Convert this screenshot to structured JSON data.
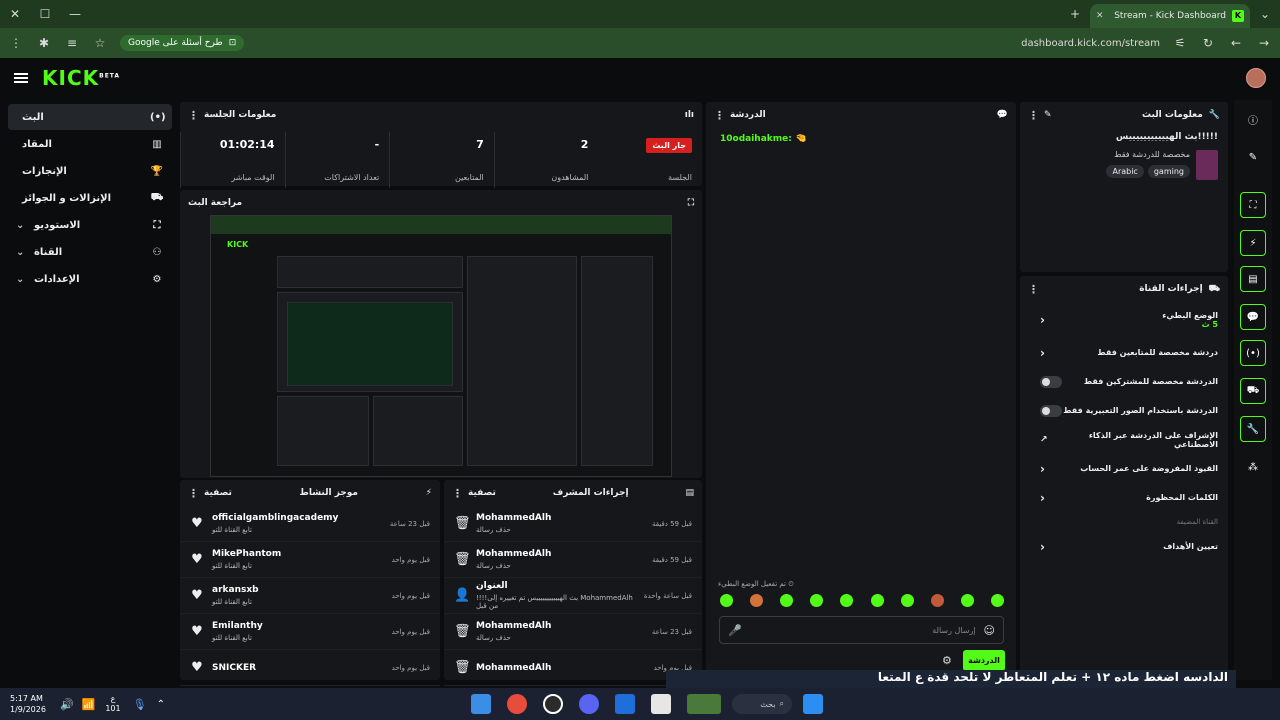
{
  "browser": {
    "tab_title": "Stream - Kick Dashboard",
    "url": "dashboard.kick.com/stream",
    "google_pill": "Google طرح أسئلة على"
  },
  "header": {
    "logo": "KICK",
    "beta": "BETA"
  },
  "nav": [
    {
      "label": "البث",
      "icon": "(•)"
    },
    {
      "label": "المقاد",
      "icon": "▥"
    },
    {
      "label": "الإنجازات",
      "icon": "🏆"
    },
    {
      "label": "الإنزالات و الجوائز",
      "icon": "⛟"
    },
    {
      "label": "الاستوديو",
      "icon": "⛶"
    },
    {
      "label": "القناة",
      "icon": "⚇"
    },
    {
      "label": "الإعدادات",
      "icon": "⚙"
    }
  ],
  "session": {
    "title": "معلومات الجلسة",
    "live_button": "جار البث",
    "session_label": "الجلسة",
    "viewers_value": "2",
    "viewers_label": "المشاهدون",
    "followers_value": "7",
    "followers_label": "المتابعين",
    "subs_value": "-",
    "subs_label": "تعداد الاشتراكات",
    "live_time_value": "01:02:14",
    "live_time_label": "الوقت مباشر"
  },
  "preview": {
    "title": "مراجعة البث"
  },
  "activity": {
    "title": "موجز النشاط",
    "filter": "تصفية",
    "items": [
      {
        "name": "officialgamblingacademy",
        "sub": "تابع القناة للتو",
        "time": "قبل 23 ساعة"
      },
      {
        "name": "MikePhantom",
        "sub": "تابع القناة للتو",
        "time": "قبل يوم واحد"
      },
      {
        "name": "arkansxb",
        "sub": "تابع القناة للتو",
        "time": "قبل يوم واحد"
      },
      {
        "name": "Emilanthy",
        "sub": "تابع القناة للتو",
        "time": "قبل يوم واحد"
      },
      {
        "name": "SNICKER",
        "sub": "",
        "time": "قبل يوم واحد"
      }
    ]
  },
  "mod": {
    "title": "إجراءات المشرف",
    "filter": "تصفية",
    "items": [
      {
        "name": "MohammedAlh",
        "sub": "حذف رسالة",
        "time": "قبل 59 دقيقة"
      },
      {
        "name": "MohammedAlh",
        "sub": "حذف رسالة",
        "time": "قبل 59 دقيقة"
      },
      {
        "name": "العنوان",
        "sub": "!!!!بث الهيييييييييييس تم تغييره إلى MohammedAlh من قبل",
        "time": "قبل ساعة واحدة"
      },
      {
        "name": "MohammedAlh",
        "sub": "حذف رسالة",
        "time": "قبل 23 ساعة"
      },
      {
        "name": "MohammedAlh",
        "sub": "",
        "time": "قبل يوم واحد"
      }
    ]
  },
  "chat": {
    "title": "الدردشة",
    "message_user": "10odaihakme:",
    "slow_mode_notice": "تم تفعيل الوضع البطيء",
    "input_placeholder": "إرسال رسالة",
    "send_button": "الدردشة"
  },
  "stream_info": {
    "title": "معلومات البث",
    "stream_title": "!!!!!بث الهيييييييييييس",
    "category": "مخصصة للدردشة فقط",
    "tags": [
      "Arabic",
      "gaming"
    ]
  },
  "channel_actions": {
    "title": "إجراءات القناة",
    "items": [
      {
        "label": "الوضع البطيء",
        "sub": "5 ث",
        "control": "chevron"
      },
      {
        "label": "دردشة مخصصة للمتابعين فقط",
        "control": "chevron"
      },
      {
        "label": "الدردشة مخصصة للمشتركين فقط",
        "control": "toggle"
      },
      {
        "label": "الدردشة باستخدام الصور التعبيرية فقط",
        "control": "toggle"
      },
      {
        "label": "الإشراف على الدردشة عبر الذكاء الاصطناعي",
        "control": "external"
      },
      {
        "label": "القيود المفروضة على عمر الحساب",
        "control": "chevron"
      },
      {
        "label": "الكلمات المحظورة",
        "control": "chevron"
      }
    ],
    "section_label": "القناة المضيفة",
    "host_item": "تعيين الأهداف"
  },
  "taskbar": {
    "time": "5:17 AM",
    "date": "1/9/2026",
    "lang": "ع",
    "lang_sub": "101",
    "search_placeholder": "بحث",
    "ticker": "الدادسه اضغط ماده ١٢ + تعلم المتعاطر لا تلحد قدة ع المتعا"
  }
}
